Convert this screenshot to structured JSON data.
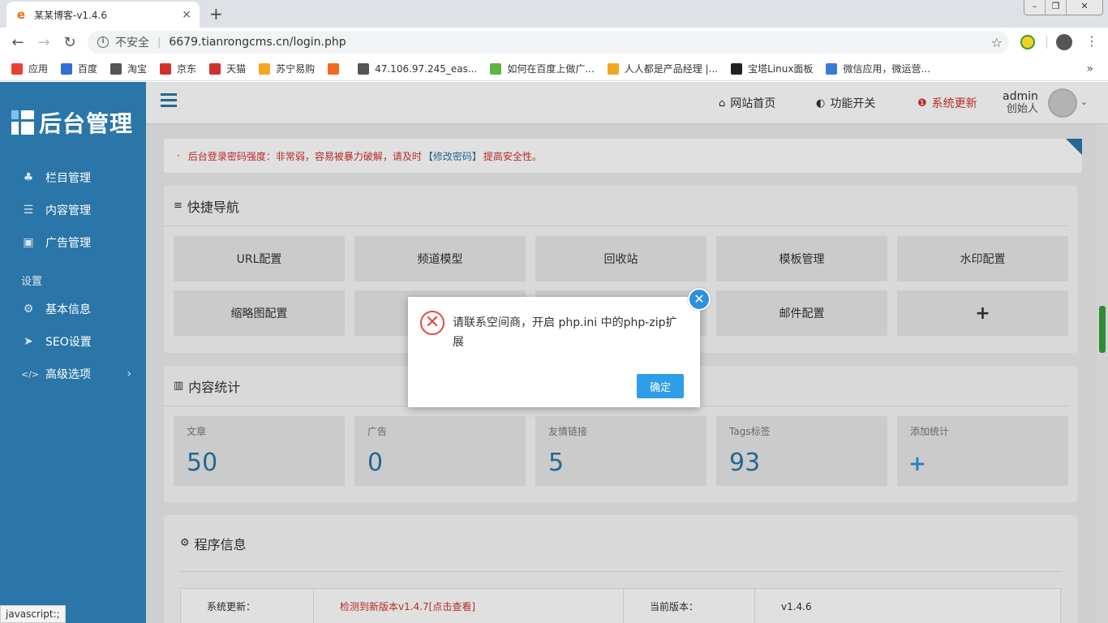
{
  "browser": {
    "tab_title": "某某博客-v1.4.6",
    "tab_close": "×",
    "new_tab": "+",
    "win_minimize": "–",
    "win_restore": "❐",
    "win_close": "✕",
    "back": "←",
    "forward": "→",
    "reload": "↻",
    "insecure_label": "不安全",
    "url": "6679.tianrongcms.cn/login.php",
    "star": "☆",
    "menu": "⋮",
    "bookmarks": [
      {
        "label": "应用",
        "icon": "apps-grid-icon",
        "color": "#e94235"
      },
      {
        "label": "百度",
        "icon": "baidu-paw-icon",
        "color": "#2f6fd6"
      },
      {
        "label": "淘宝",
        "icon": "globe-icon",
        "color": "#555555"
      },
      {
        "label": "京东",
        "icon": "jd-icon",
        "color": "#d0312d"
      },
      {
        "label": "天猫",
        "icon": "tmall-icon",
        "color": "#d0312d"
      },
      {
        "label": "苏宁易购",
        "icon": "suning-icon",
        "color": "#f5a623"
      },
      {
        "label": "",
        "icon": "orange-bracket-icon",
        "color": "#f26b1d"
      },
      {
        "label": "47.106.97.245_eas...",
        "icon": "globe-icon",
        "color": "#555555"
      },
      {
        "label": "如何在百度上做广...",
        "icon": "green-circle-icon",
        "color": "#5db53b"
      },
      {
        "label": "人人都是产品经理 |...",
        "icon": "rr-icon",
        "color": "#f5a623"
      },
      {
        "label": "宝塔Linux面板",
        "icon": "bt-icon",
        "color": "#222222"
      },
      {
        "label": "微信应用，微运营...",
        "icon": "m-icon",
        "color": "#3a7bd5"
      }
    ],
    "bookmarks_more": "»",
    "status_text": "javascript:;"
  },
  "sidebar": {
    "logo_text": "后台管理",
    "items": [
      {
        "icon": "sitemap-icon",
        "glyph": "♣",
        "label": "栏目管理"
      },
      {
        "icon": "list-icon",
        "glyph": "☰",
        "label": "内容管理"
      },
      {
        "icon": "image-icon",
        "glyph": "▣",
        "label": "广告管理"
      }
    ],
    "group_label": "设置",
    "settings": [
      {
        "icon": "gear-icon",
        "glyph": "⚙",
        "label": "基本信息"
      },
      {
        "icon": "paper-plane-icon",
        "glyph": "➤",
        "label": "SEO设置"
      },
      {
        "icon": "code-icon",
        "glyph": "</>",
        "label": "高级选项",
        "chevron": "›"
      }
    ]
  },
  "header": {
    "home_glyph": "⌂",
    "home": "网站首页",
    "toggle_glyph": "◐",
    "toggle": "功能开关",
    "update_glyph": "❶",
    "update": "系统更新",
    "user_name": "admin",
    "user_role": "创始人",
    "caret": "⌄"
  },
  "notice": {
    "dot": "·",
    "before": "后台登录密码强度：非常弱，容易被暴力破解，请及时",
    "link": "【修改密码】",
    "after": "提高安全性。"
  },
  "quick_nav": {
    "title": "快捷导航",
    "title_glyph": "≡",
    "items": [
      "URL配置",
      "频道模型",
      "回收站",
      "模板管理",
      "水印配置",
      "缩略图配置",
      "",
      "",
      "邮件配置",
      "+"
    ]
  },
  "stats": {
    "title": "内容统计",
    "title_glyph": "▥",
    "items": [
      {
        "label": "文章",
        "value": "50"
      },
      {
        "label": "广告",
        "value": "0"
      },
      {
        "label": "友情链接",
        "value": "5"
      },
      {
        "label": "Tags标签",
        "value": "93"
      },
      {
        "label": "添加统计",
        "value": "+"
      }
    ]
  },
  "program_info": {
    "title": "程序信息",
    "title_glyph": "⚙",
    "row1": {
      "label1": "系统更新：",
      "value1": "检测到新版本v1.4.7[点击查看]",
      "label2": "当前版本：",
      "value2": "v1.4.6"
    }
  },
  "dialog": {
    "icon_glyph": "✕",
    "message": "请联系空间商，开启 php.ini 中的php-zip扩展",
    "ok": "确定",
    "close_glyph": "✕"
  },
  "colors": {
    "sidebar": "#2a76a8",
    "accent": "#2d9ee8",
    "danger": "#d0312d"
  }
}
